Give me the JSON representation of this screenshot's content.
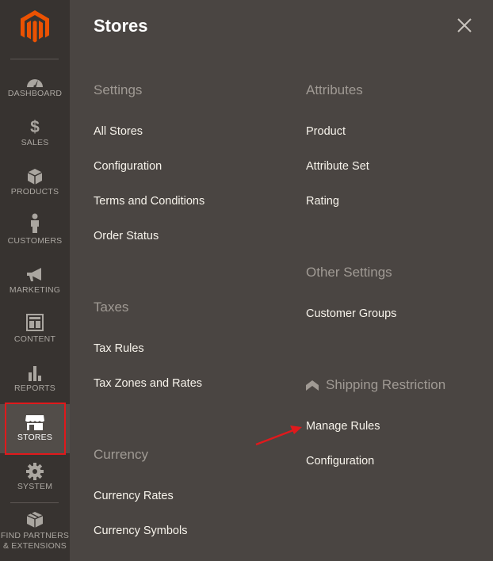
{
  "sidebar": {
    "logo_icon": "magento-logo",
    "items": [
      {
        "label": "DASHBOARD",
        "icon": "dashboard-icon"
      },
      {
        "label": "SALES",
        "icon": "dollar-icon"
      },
      {
        "label": "PRODUCTS",
        "icon": "box-icon"
      },
      {
        "label": "CUSTOMERS",
        "icon": "person-icon"
      },
      {
        "label": "MARKETING",
        "icon": "megaphone-icon"
      },
      {
        "label": "CONTENT",
        "icon": "layout-icon"
      },
      {
        "label": "REPORTS",
        "icon": "bar-chart-icon"
      },
      {
        "label": "STORES",
        "icon": "storefront-icon",
        "active": true
      },
      {
        "label": "SYSTEM",
        "icon": "gear-icon"
      },
      {
        "label_line1": "FIND PARTNERS",
        "label_line2": "& EXTENSIONS",
        "icon": "extensions-icon"
      }
    ]
  },
  "panel": {
    "title": "Stores",
    "columns": {
      "left": [
        {
          "title": "Settings",
          "items": [
            "All Stores",
            "Configuration",
            "Terms and Conditions",
            "Order Status"
          ]
        },
        {
          "title": "Taxes",
          "items": [
            "Tax Rules",
            "Tax Zones and Rates"
          ]
        },
        {
          "title": "Currency",
          "items": [
            "Currency Rates",
            "Currency Symbols"
          ]
        }
      ],
      "right": [
        {
          "title": "Attributes",
          "items": [
            "Product",
            "Attribute Set",
            "Rating"
          ]
        },
        {
          "title": "Other Settings",
          "items": [
            "Customer Groups"
          ]
        },
        {
          "title": "Shipping Restriction",
          "items": [
            "Manage Rules",
            "Configuration"
          ]
        }
      ]
    }
  },
  "colors": {
    "sidebar_bg": "#373330",
    "panel_bg": "#4a4542",
    "accent": "#eb5202",
    "highlight": "#e0191c"
  }
}
